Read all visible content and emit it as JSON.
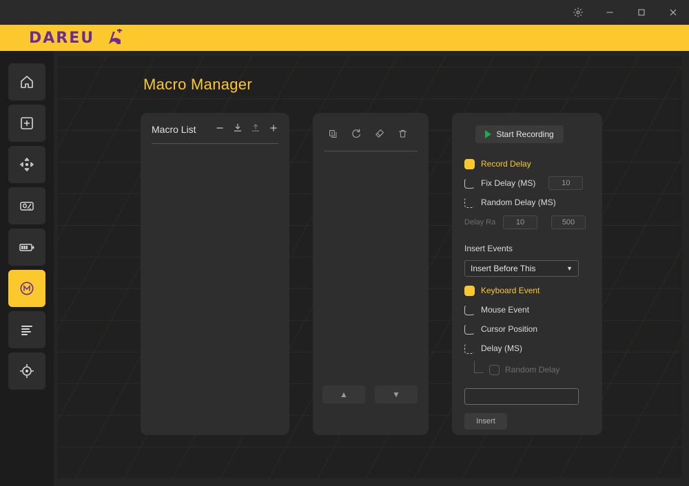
{
  "titlebar": {
    "buttons": [
      {
        "name": "settings",
        "icon": "gear-icon"
      },
      {
        "name": "minimize",
        "icon": "minimize-icon"
      },
      {
        "name": "maximize",
        "icon": "maximize-icon"
      },
      {
        "name": "close",
        "icon": "close-icon"
      }
    ]
  },
  "brand": {
    "name": "DAREU",
    "accent_color": "#fbc82e",
    "logo_color": "#6b2d8f"
  },
  "sidebar": {
    "items": [
      {
        "icon": "home-icon",
        "label": "Home",
        "active": false
      },
      {
        "icon": "add-square-icon",
        "label": "Add",
        "active": false
      },
      {
        "icon": "dpi-move-icon",
        "label": "Movement",
        "active": false
      },
      {
        "icon": "percent-icon",
        "label": "Sensitivity",
        "active": false
      },
      {
        "icon": "battery-icon",
        "label": "Battery",
        "active": false
      },
      {
        "icon": "macro-m-icon",
        "label": "Macro",
        "active": true
      },
      {
        "icon": "align-list-icon",
        "label": "Report Rate",
        "active": false
      },
      {
        "icon": "crosshair-icon",
        "label": "Calibration",
        "active": false
      }
    ]
  },
  "main": {
    "page_title": "Macro Manager"
  },
  "macro_list": {
    "title": "Macro List",
    "tools": [
      {
        "icon": "minus-icon",
        "label": "Delete Macro"
      },
      {
        "icon": "download-icon",
        "label": "Import Macro"
      },
      {
        "icon": "upload-icon",
        "label": "Export Macro"
      },
      {
        "icon": "plus-icon",
        "label": "New Macro"
      }
    ],
    "items": []
  },
  "macro_steps": {
    "tools": [
      {
        "icon": "copy-icon",
        "label": "Copy"
      },
      {
        "icon": "redo-icon",
        "label": "Repeat"
      },
      {
        "icon": "eraser-icon",
        "label": "Edit"
      },
      {
        "icon": "trash-icon",
        "label": "Delete"
      }
    ],
    "items": [],
    "move_up_label": "▲",
    "move_down_label": "▼"
  },
  "properties": {
    "record_button_label": "Start Recording",
    "record_delay": {
      "label": "Record Delay",
      "checked": true
    },
    "fix_delay": {
      "label": "Fix Delay (MS)",
      "checked": false,
      "value": "10"
    },
    "random_delay": {
      "label": "Random Delay (MS)",
      "checked": false
    },
    "delay_range": {
      "label": "Delay Ra",
      "min": "10",
      "max": "500"
    },
    "insert_events_label": "Insert Events",
    "insert_position": {
      "selected": "Insert Before This",
      "caret": "▼"
    },
    "event_types": [
      {
        "label": "Keyboard Event",
        "checked": true,
        "dim": false
      },
      {
        "label": "Mouse Event",
        "checked": false,
        "dim": false
      },
      {
        "label": "Cursor Position",
        "checked": false,
        "dim": false
      },
      {
        "label": "Delay (MS)",
        "checked": false,
        "dim": false
      }
    ],
    "nested_random_delay": {
      "label": "Random Delay",
      "checked": false,
      "dim": true
    },
    "value_input": {
      "value": "",
      "placeholder": ""
    },
    "insert_button_label": "Insert"
  }
}
